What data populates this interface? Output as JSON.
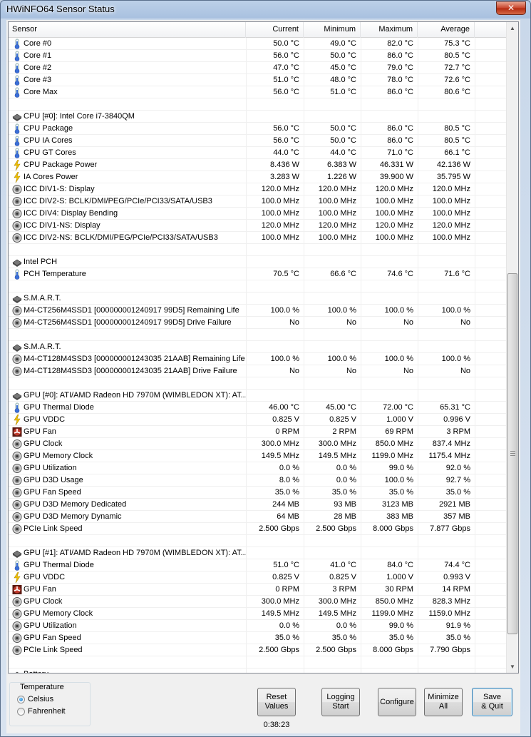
{
  "window": {
    "title": "HWiNFO64 Sensor Status",
    "close_glyph": "✕"
  },
  "columns": {
    "sensor": "Sensor",
    "current": "Current",
    "minimum": "Minimum",
    "maximum": "Maximum",
    "average": "Average"
  },
  "rows": [
    {
      "type": "sensor",
      "icon": "thermometer-icon",
      "name": "Core #0",
      "cur": "50.0 °C",
      "min": "49.0 °C",
      "max": "82.0 °C",
      "avg": "75.3 °C"
    },
    {
      "type": "sensor",
      "icon": "thermometer-icon",
      "name": "Core #1",
      "cur": "56.0 °C",
      "min": "50.0 °C",
      "max": "86.0 °C",
      "avg": "80.5 °C"
    },
    {
      "type": "sensor",
      "icon": "thermometer-icon",
      "name": "Core #2",
      "cur": "47.0 °C",
      "min": "45.0 °C",
      "max": "79.0 °C",
      "avg": "72.7 °C"
    },
    {
      "type": "sensor",
      "icon": "thermometer-icon",
      "name": "Core #3",
      "cur": "51.0 °C",
      "min": "48.0 °C",
      "max": "78.0 °C",
      "avg": "72.6 °C"
    },
    {
      "type": "sensor",
      "icon": "thermometer-icon",
      "name": "Core Max",
      "cur": "56.0 °C",
      "min": "51.0 °C",
      "max": "86.0 °C",
      "avg": "80.6 °C"
    },
    {
      "type": "blank"
    },
    {
      "type": "group",
      "icon": "chip-icon",
      "name": "CPU [#0]: Intel Core i7-3840QM"
    },
    {
      "type": "sensor",
      "icon": "thermometer-icon",
      "name": "CPU Package",
      "cur": "56.0 °C",
      "min": "50.0 °C",
      "max": "86.0 °C",
      "avg": "80.5 °C"
    },
    {
      "type": "sensor",
      "icon": "thermometer-icon",
      "name": "CPU IA Cores",
      "cur": "56.0 °C",
      "min": "50.0 °C",
      "max": "86.0 °C",
      "avg": "80.5 °C"
    },
    {
      "type": "sensor",
      "icon": "thermometer-icon",
      "name": "CPU GT Cores",
      "cur": "44.0 °C",
      "min": "44.0 °C",
      "max": "71.0 °C",
      "avg": "66.1 °C"
    },
    {
      "type": "sensor",
      "icon": "lightning-icon",
      "name": "CPU Package Power",
      "cur": "8.436 W",
      "min": "6.383 W",
      "max": "46.331 W",
      "avg": "42.136 W"
    },
    {
      "type": "sensor",
      "icon": "lightning-icon",
      "name": "IA Cores Power",
      "cur": "3.283 W",
      "min": "1.226 W",
      "max": "39.900 W",
      "avg": "35.795 W"
    },
    {
      "type": "sensor",
      "icon": "gauge-icon",
      "name": "ICC DIV1-S: Display",
      "cur": "120.0 MHz",
      "min": "120.0 MHz",
      "max": "120.0 MHz",
      "avg": "120.0 MHz"
    },
    {
      "type": "sensor",
      "icon": "gauge-icon",
      "name": "ICC DIV2-S: BCLK/DMI/PEG/PCIe/PCI33/SATA/USB3",
      "cur": "100.0 MHz",
      "min": "100.0 MHz",
      "max": "100.0 MHz",
      "avg": "100.0 MHz"
    },
    {
      "type": "sensor",
      "icon": "gauge-icon",
      "name": "ICC DIV4: Display Bending",
      "cur": "100.0 MHz",
      "min": "100.0 MHz",
      "max": "100.0 MHz",
      "avg": "100.0 MHz"
    },
    {
      "type": "sensor",
      "icon": "gauge-icon",
      "name": "ICC DIV1-NS: Display",
      "cur": "120.0 MHz",
      "min": "120.0 MHz",
      "max": "120.0 MHz",
      "avg": "120.0 MHz"
    },
    {
      "type": "sensor",
      "icon": "gauge-icon",
      "name": "ICC DIV2-NS: BCLK/DMI/PEG/PCIe/PCI33/SATA/USB3",
      "cur": "100.0 MHz",
      "min": "100.0 MHz",
      "max": "100.0 MHz",
      "avg": "100.0 MHz"
    },
    {
      "type": "blank"
    },
    {
      "type": "group",
      "icon": "chip-icon",
      "name": "Intel PCH"
    },
    {
      "type": "sensor",
      "icon": "thermometer-icon",
      "name": "PCH Temperature",
      "cur": "70.5 °C",
      "min": "66.6 °C",
      "max": "74.6 °C",
      "avg": "71.6 °C"
    },
    {
      "type": "blank"
    },
    {
      "type": "group",
      "icon": "chip-icon",
      "name": "S.M.A.R.T."
    },
    {
      "type": "sensor",
      "icon": "gauge-icon",
      "name": "M4-CT256M4SSD1 [000000001240917 99D5] Remaining Life",
      "cur": "100.0 %",
      "min": "100.0 %",
      "max": "100.0 %",
      "avg": "100.0 %"
    },
    {
      "type": "sensor",
      "icon": "gauge-icon",
      "name": "M4-CT256M4SSD1 [000000001240917 99D5] Drive Failure",
      "cur": "No",
      "min": "No",
      "max": "No",
      "avg": "No"
    },
    {
      "type": "blank"
    },
    {
      "type": "group",
      "icon": "chip-icon",
      "name": "S.M.A.R.T."
    },
    {
      "type": "sensor",
      "icon": "gauge-icon",
      "name": "M4-CT128M4SSD3 [000000001243035 21AAB] Remaining Life",
      "cur": "100.0 %",
      "min": "100.0 %",
      "max": "100.0 %",
      "avg": "100.0 %"
    },
    {
      "type": "sensor",
      "icon": "gauge-icon",
      "name": "M4-CT128M4SSD3 [000000001243035 21AAB] Drive Failure",
      "cur": "No",
      "min": "No",
      "max": "No",
      "avg": "No"
    },
    {
      "type": "blank"
    },
    {
      "type": "group",
      "icon": "chip-icon",
      "name": "GPU [#0]: ATI/AMD Radeon HD 7970M (WIMBLEDON XT): AT..."
    },
    {
      "type": "sensor",
      "icon": "thermometer-icon",
      "name": "GPU Thermal Diode",
      "cur": "46.00 °C",
      "min": "45.00 °C",
      "max": "72.00 °C",
      "avg": "65.31 °C"
    },
    {
      "type": "sensor",
      "icon": "lightning-icon",
      "name": "GPU VDDC",
      "cur": "0.825 V",
      "min": "0.825 V",
      "max": "1.000 V",
      "avg": "0.996 V"
    },
    {
      "type": "sensor",
      "icon": "fan-icon",
      "name": "GPU Fan",
      "cur": "0 RPM",
      "min": "2 RPM",
      "max": "69 RPM",
      "avg": "3 RPM"
    },
    {
      "type": "sensor",
      "icon": "gauge-icon",
      "name": "GPU Clock",
      "cur": "300.0 MHz",
      "min": "300.0 MHz",
      "max": "850.0 MHz",
      "avg": "837.4 MHz"
    },
    {
      "type": "sensor",
      "icon": "gauge-icon",
      "name": "GPU Memory Clock",
      "cur": "149.5 MHz",
      "min": "149.5 MHz",
      "max": "1199.0 MHz",
      "avg": "1175.4 MHz"
    },
    {
      "type": "sensor",
      "icon": "gauge-icon",
      "name": "GPU Utilization",
      "cur": "0.0 %",
      "min": "0.0 %",
      "max": "99.0 %",
      "avg": "92.0 %"
    },
    {
      "type": "sensor",
      "icon": "gauge-icon",
      "name": "GPU D3D Usage",
      "cur": "8.0 %",
      "min": "0.0 %",
      "max": "100.0 %",
      "avg": "92.7 %"
    },
    {
      "type": "sensor",
      "icon": "gauge-icon",
      "name": "GPU Fan Speed",
      "cur": "35.0 %",
      "min": "35.0 %",
      "max": "35.0 %",
      "avg": "35.0 %"
    },
    {
      "type": "sensor",
      "icon": "gauge-icon",
      "name": "GPU D3D Memory Dedicated",
      "cur": "244 MB",
      "min": "93 MB",
      "max": "3123 MB",
      "avg": "2921 MB"
    },
    {
      "type": "sensor",
      "icon": "gauge-icon",
      "name": "GPU D3D Memory Dynamic",
      "cur": "64 MB",
      "min": "28 MB",
      "max": "383 MB",
      "avg": "357 MB"
    },
    {
      "type": "sensor",
      "icon": "gauge-icon",
      "name": "PCIe Link Speed",
      "cur": "2.500 Gbps",
      "min": "2.500 Gbps",
      "max": "8.000 Gbps",
      "avg": "7.877 Gbps"
    },
    {
      "type": "blank"
    },
    {
      "type": "group",
      "icon": "chip-icon",
      "name": "GPU [#1]: ATI/AMD Radeon HD 7970M (WIMBLEDON XT): AT..."
    },
    {
      "type": "sensor",
      "icon": "thermometer-icon",
      "name": "GPU Thermal Diode",
      "cur": "51.0 °C",
      "min": "41.0 °C",
      "max": "84.0 °C",
      "avg": "74.4 °C"
    },
    {
      "type": "sensor",
      "icon": "lightning-icon",
      "name": "GPU VDDC",
      "cur": "0.825 V",
      "min": "0.825 V",
      "max": "1.000 V",
      "avg": "0.993 V"
    },
    {
      "type": "sensor",
      "icon": "fan-icon",
      "name": "GPU Fan",
      "cur": "0 RPM",
      "min": "3 RPM",
      "max": "30 RPM",
      "avg": "14 RPM"
    },
    {
      "type": "sensor",
      "icon": "gauge-icon",
      "name": "GPU Clock",
      "cur": "300.0 MHz",
      "min": "300.0 MHz",
      "max": "850.0 MHz",
      "avg": "828.3 MHz"
    },
    {
      "type": "sensor",
      "icon": "gauge-icon",
      "name": "GPU Memory Clock",
      "cur": "149.5 MHz",
      "min": "149.5 MHz",
      "max": "1199.0 MHz",
      "avg": "1159.0 MHz"
    },
    {
      "type": "sensor",
      "icon": "gauge-icon",
      "name": "GPU Utilization",
      "cur": "0.0 %",
      "min": "0.0 %",
      "max": "99.0 %",
      "avg": "91.9 %"
    },
    {
      "type": "sensor",
      "icon": "gauge-icon",
      "name": "GPU Fan Speed",
      "cur": "35.0 %",
      "min": "35.0 %",
      "max": "35.0 %",
      "avg": "35.0 %"
    },
    {
      "type": "sensor",
      "icon": "gauge-icon",
      "name": "PCIe Link Speed",
      "cur": "2.500 Gbps",
      "min": "2.500 Gbps",
      "max": "8.000 Gbps",
      "avg": "7.790 Gbps"
    },
    {
      "type": "blank"
    },
    {
      "type": "group",
      "icon": "chip-icon",
      "name": "Battery"
    }
  ],
  "temperature": {
    "title": "Temperature",
    "options": [
      "Celsius",
      "Fahrenheit"
    ],
    "selected": "Celsius"
  },
  "buttons": {
    "reset": "Reset\nValues",
    "logging": "Logging\nStart",
    "configure": "Configure",
    "minimize": "Minimize\nAll",
    "save": "Save\n& Quit"
  },
  "timer": "0:38:23",
  "scrollbar": {
    "up_glyph": "▲",
    "down_glyph": "▼"
  },
  "colors": {
    "thermometer": "#3a6fd8",
    "lightning": "#f2c200",
    "fan": "#c0392b",
    "gauge": "#555555"
  }
}
